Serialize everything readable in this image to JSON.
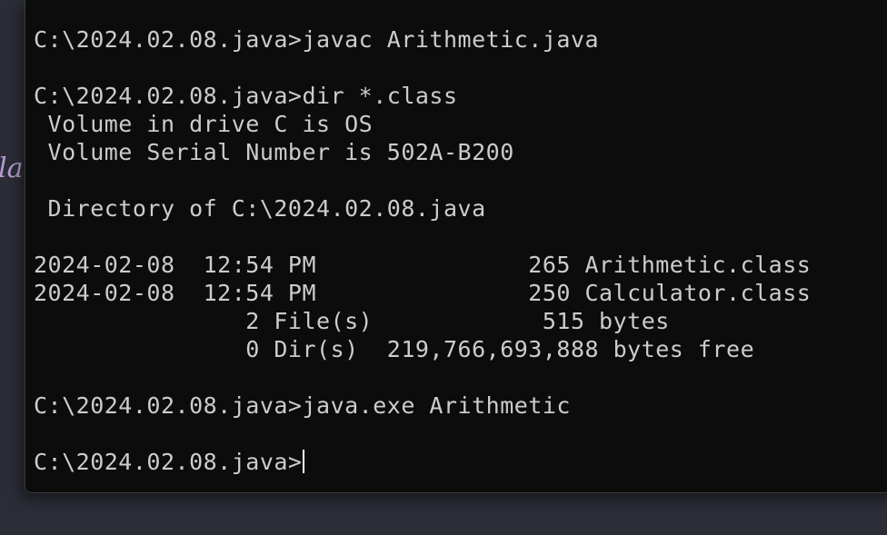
{
  "background": {
    "partial_text": "la",
    "colors": {
      "desktop": "#2b2d36",
      "accent_text": "#b69bd0"
    }
  },
  "terminal": {
    "colors": {
      "background": "#0c0c0c",
      "foreground": "#cccccc",
      "cursor": "#ffffff"
    },
    "lines": [
      "C:\\2024.02.08.java>javac Arithmetic.java",
      "",
      "C:\\2024.02.08.java>dir *.class",
      " Volume in drive C is OS",
      " Volume Serial Number is 502A-B200",
      "",
      " Directory of C:\\2024.02.08.java",
      "",
      "2024-02-08  12:54 PM               265 Arithmetic.class",
      "2024-02-08  12:54 PM               250 Calculator.class",
      "               2 File(s)            515 bytes",
      "               0 Dir(s)  219,766,693,888 bytes free",
      "",
      "C:\\2024.02.08.java>java.exe Arithmetic",
      ""
    ],
    "prompt": "C:\\2024.02.08.java>"
  }
}
